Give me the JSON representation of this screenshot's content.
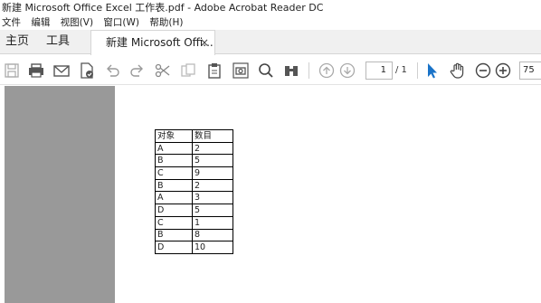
{
  "window": {
    "title": "新建 Microsoft Office Excel 工作表.pdf - Adobe Acrobat Reader DC"
  },
  "menu": [
    "文件",
    "编辑",
    "视图(V)",
    "窗口(W)",
    "帮助(H)"
  ],
  "tabs": {
    "home": "主页",
    "tools": "工具",
    "document": "新建 Microsoft Offi...",
    "close": "×"
  },
  "toolbar": {
    "page_current": "1",
    "page_total": "/ 1",
    "zoom": "75"
  },
  "table": {
    "headers": [
      "对象",
      "数目"
    ],
    "rows": [
      [
        "A",
        "2"
      ],
      [
        "B",
        "5"
      ],
      [
        "C",
        "9"
      ],
      [
        "B",
        "2"
      ],
      [
        "A",
        "3"
      ],
      [
        "D",
        "5"
      ],
      [
        "C",
        "1"
      ],
      [
        "B",
        "8"
      ],
      [
        "D",
        "10"
      ]
    ]
  }
}
